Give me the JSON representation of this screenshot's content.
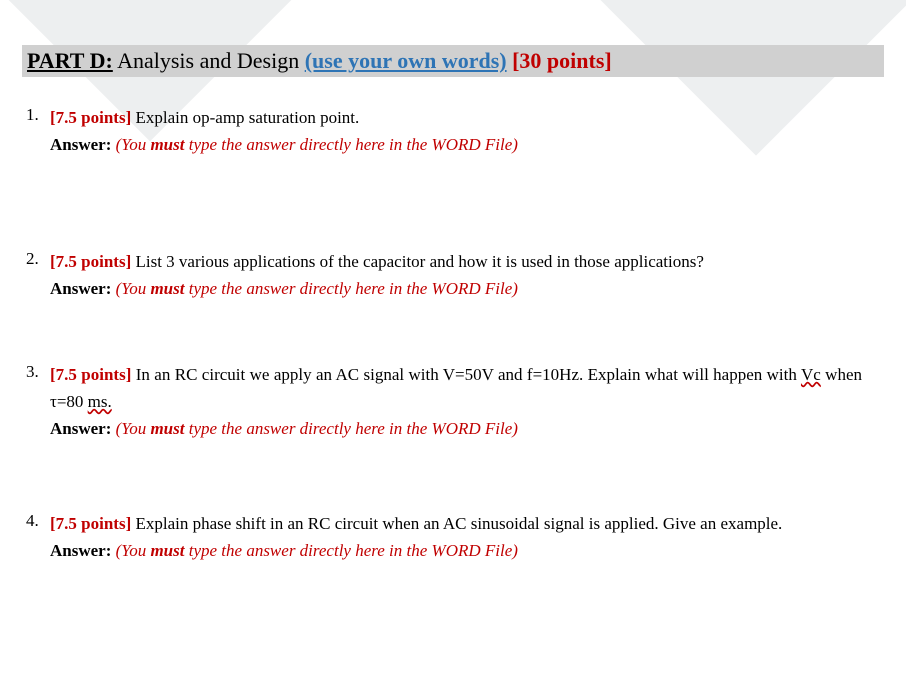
{
  "header": {
    "part_label": "PART D:",
    "section_title": "Analysis and Design",
    "hint_text": "(use your own words)",
    "points_text": "[30 points]"
  },
  "answer_hint": {
    "prefix": "(You ",
    "must": "must",
    "suffix": " type the answer directly here in the WORD File)"
  },
  "answer_label": "Answer: ",
  "questions": [
    {
      "number": "1.",
      "points": "[7.5 points]",
      "text": " Explain op-amp saturation point."
    },
    {
      "number": "2.",
      "points": "[7.5 points]",
      "text": " List 3 various applications of the capacitor and how it is used in those applications?"
    },
    {
      "number": "3.",
      "points": "[7.5 points]",
      "text_before_vc": " In an RC circuit we apply an AC signal with V=50V and f=10Hz. Explain what will happen with ",
      "vc": "Vc",
      "text_mid": " when τ=80 ",
      "ms": "ms.",
      "text_after": ""
    },
    {
      "number": "4.",
      "points": "[7.5 points]",
      "text": " Explain phase shift in an RC circuit when an AC sinusoidal signal is applied. Give an example."
    }
  ]
}
